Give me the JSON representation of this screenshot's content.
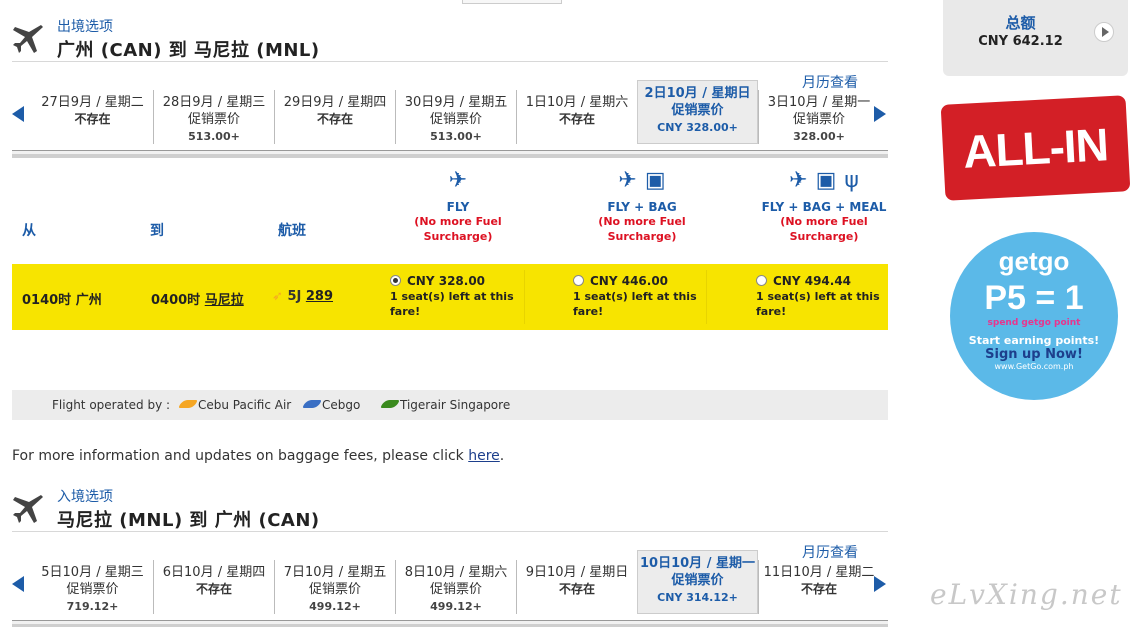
{
  "outbound": {
    "label": "出境选项",
    "route": "广州 (CAN) 到 马尼拉 (MNL)",
    "calendar_link": "月历查看",
    "days": [
      {
        "date": "27日9月 / 星期二",
        "status": "不存在",
        "price": ""
      },
      {
        "date": "28日9月 / 星期三",
        "status": "促销票价",
        "price": "513.00+"
      },
      {
        "date": "29日9月 / 星期四",
        "status": "不存在",
        "price": ""
      },
      {
        "date": "30日9月 / 星期五",
        "status": "促销票价",
        "price": "513.00+"
      },
      {
        "date": "1日10月 / 星期六",
        "status": "不存在",
        "price": ""
      },
      {
        "date": "2日10月 / 星期日",
        "status": "促销票价",
        "price": "CNY 328.00+"
      },
      {
        "date": "3日10月 / 星期一",
        "status": "促销票价",
        "price": "328.00+"
      }
    ],
    "selected_index": 5
  },
  "columns": {
    "from": "从",
    "to": "到",
    "flight": "航班"
  },
  "fares": [
    {
      "name": "FLY",
      "note1": "(No more Fuel",
      "note2": "Surcharge)"
    },
    {
      "name": "FLY + BAG",
      "note1": "(No more Fuel",
      "note2": "Surcharge)"
    },
    {
      "name": "FLY + BAG + MEAL",
      "note1": "(No more Fuel",
      "note2": "Surcharge)"
    }
  ],
  "flight": {
    "depart_time": "0140时",
    "depart_city": "广州",
    "arrive_time": "0400时",
    "arrive_city": "马尼拉",
    "airline_code": "5J",
    "number": "289",
    "fares": [
      {
        "price": "CNY 328.00",
        "seats": "1 seat(s) left at this",
        "seats2": "fare!",
        "selected": true
      },
      {
        "price": "CNY 446.00",
        "seats": "1 seat(s) left at this",
        "seats2": "fare!",
        "selected": false
      },
      {
        "price": "CNY 494.44",
        "seats": "1 seat(s) left at this",
        "seats2": "fare!",
        "selected": false
      }
    ]
  },
  "operated": {
    "label": "Flight operated by :",
    "carriers": [
      {
        "name": "Cebu Pacific Air",
        "color": "#f5a623"
      },
      {
        "name": "Cebgo",
        "color": "#3a6fc4"
      },
      {
        "name": "Tigerair Singapore",
        "color": "#3a8a1e"
      }
    ]
  },
  "baggage": {
    "text": "For more information and updates on baggage fees, please click",
    "link": "here",
    "end": "."
  },
  "inbound": {
    "label": "入境选项",
    "route": "马尼拉 (MNL) 到 广州 (CAN)",
    "calendar_link": "月历查看",
    "days": [
      {
        "date": "5日10月 / 星期三",
        "status": "促销票价",
        "price": "719.12+"
      },
      {
        "date": "6日10月 / 星期四",
        "status": "不存在",
        "price": ""
      },
      {
        "date": "7日10月 / 星期五",
        "status": "促销票价",
        "price": "499.12+"
      },
      {
        "date": "8日10月 / 星期六",
        "status": "促销票价",
        "price": "499.12+"
      },
      {
        "date": "9日10月 / 星期日",
        "status": "不存在",
        "price": ""
      },
      {
        "date": "10日10月 / 星期一",
        "status": "促销票价",
        "price": "CNY 314.12+"
      },
      {
        "date": "11日10月 / 星期二",
        "status": "不存在",
        "price": ""
      }
    ],
    "selected_index": 5
  },
  "total": {
    "label": "总额",
    "amount": "CNY  642.12"
  },
  "ads": {
    "allin": "ALL-IN",
    "getgo_logo": "getgo",
    "getgo_promo": "P5 = 1",
    "getgo_sub": "spend      getgo point",
    "getgo_cta1": "Start earning points!",
    "getgo_cta2": "Sign up Now!",
    "getgo_url": "www.GetGo.com.ph"
  },
  "watermark": "eLvXing.net",
  "colors": {
    "accent": "#1d5ca8",
    "highlight": "#f7e400",
    "warning": "#d12222"
  },
  "icons": {
    "plane": "plane-icon",
    "bag": "luggage-icon",
    "meal": "fork-knife-icon"
  }
}
